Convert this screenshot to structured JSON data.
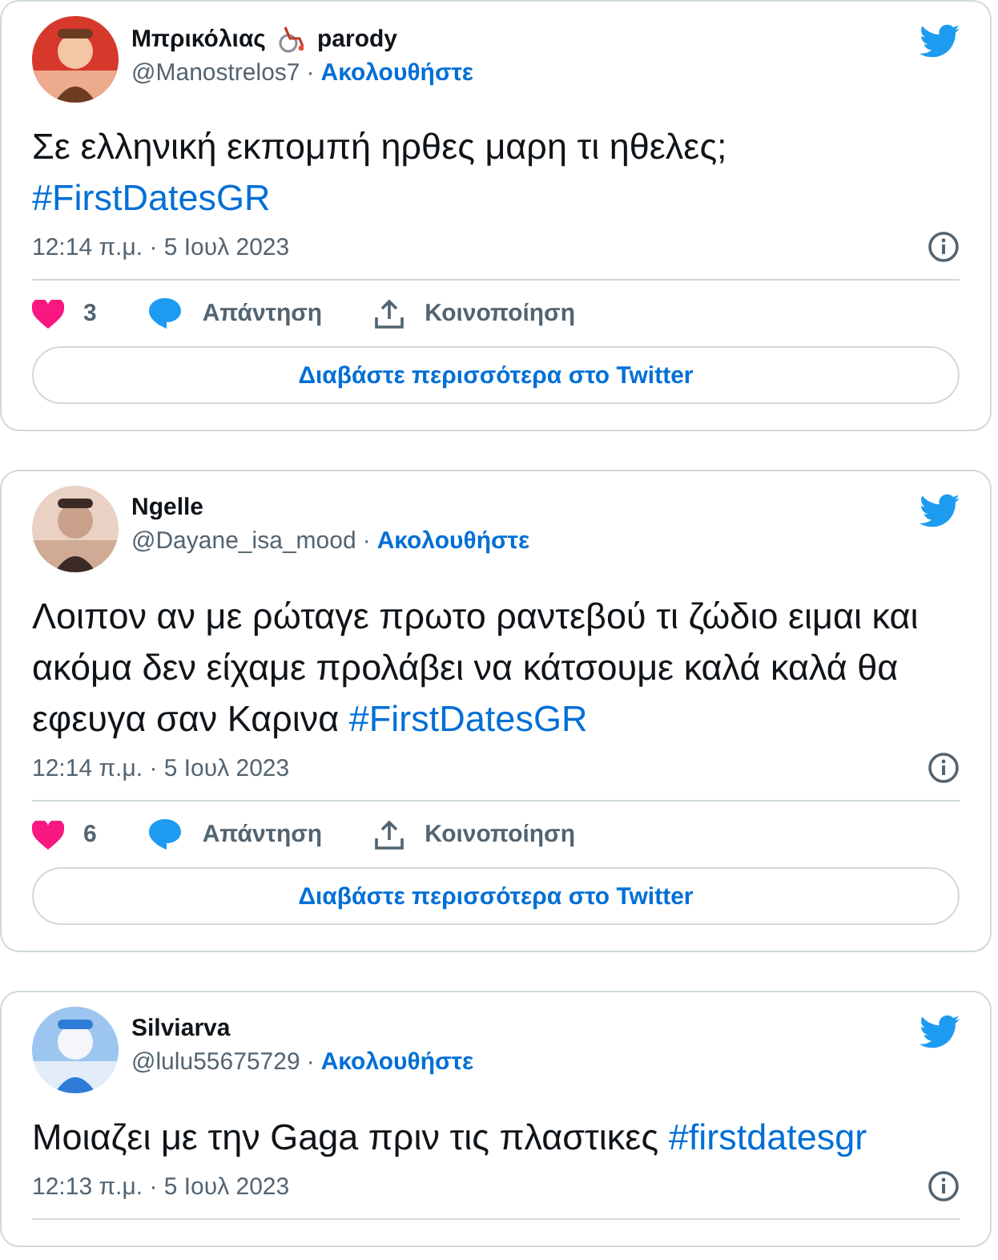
{
  "tweets": [
    {
      "name_parts": [
        {
          "kind": "text",
          "text": "Μπρικόλιας"
        },
        {
          "kind": "wheelchair"
        },
        {
          "kind": "text",
          "text": "parody"
        }
      ],
      "handle": "@Manostrelos7",
      "separator": "·",
      "follow": "Ακολουθήστε",
      "body": [
        {
          "kind": "plain",
          "text": "Σε ελληνική εκπομπή ηρθες μαρη τι ηθελες;"
        },
        {
          "kind": "hashtag",
          "text": "#FirstDatesGR",
          "break_before": true
        }
      ],
      "time": "12:14 π.μ. · 5 Ιουλ 2023",
      "likes": "3",
      "reply": "Απάντηση",
      "share": "Κοινοποίηση",
      "read_more": "Διαβάστε περισσότερα στο Twitter"
    },
    {
      "name_parts": [
        {
          "kind": "text",
          "text": "Ngelle"
        }
      ],
      "handle": "@Dayane_isa_mood",
      "separator": "·",
      "follow": "Ακολουθήστε",
      "body": [
        {
          "kind": "plain",
          "text": "Λοιπον αν με ρώταγε πρωτο ραντεβού τι ζώδιο ειμαι και ακόμα δεν είχαμε προλάβει να κάτσουμε καλά καλά θα εφευγα σαν Καρινα "
        },
        {
          "kind": "hashtag",
          "text": "#FirstDatesGR",
          "break_before": false
        }
      ],
      "time": "12:14 π.μ. · 5 Ιουλ 2023",
      "likes": "6",
      "reply": "Απάντηση",
      "share": "Κοινοποίηση",
      "read_more": "Διαβάστε περισσότερα στο Twitter"
    },
    {
      "name_parts": [
        {
          "kind": "text",
          "text": "Silviarva"
        }
      ],
      "handle": "@lulu55675729",
      "separator": "·",
      "follow": "Ακολουθήστε",
      "body": [
        {
          "kind": "plain",
          "text": "Μοιαζει με την Gaga πριν τις πλαστικες "
        },
        {
          "kind": "hashtag",
          "text": "#firstdatesgr",
          "break_before": false
        }
      ],
      "time": "12:13 π.μ. · 5 Ιουλ 2023"
    }
  ]
}
